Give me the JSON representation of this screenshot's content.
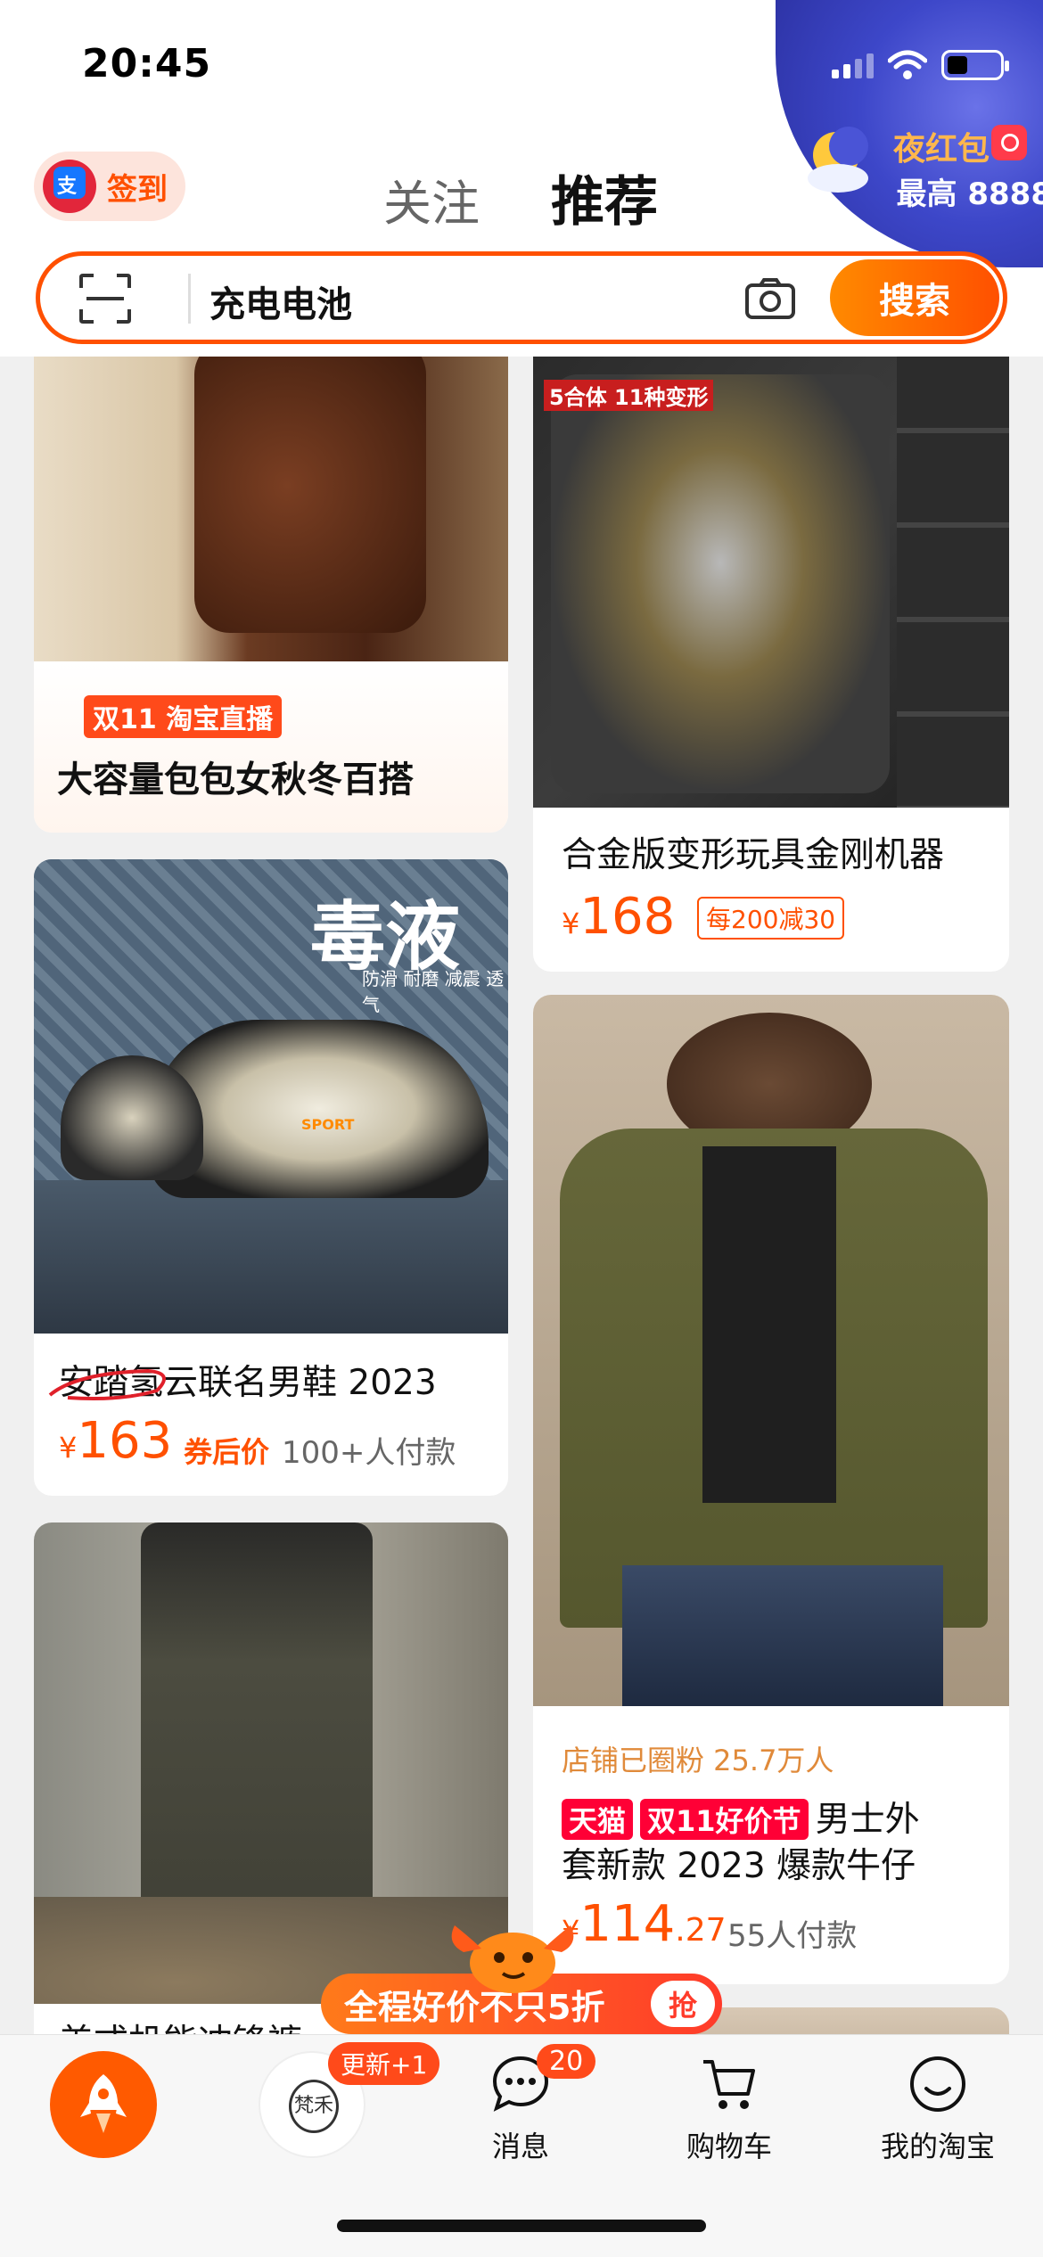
{
  "status_bar": {
    "time": "20:45"
  },
  "header": {
    "checkin_label": "签到",
    "tabs": [
      {
        "label": "关注"
      },
      {
        "label": "推荐"
      }
    ],
    "night_promo": {
      "title": "夜红包",
      "subtitle": "最高 8888"
    }
  },
  "search": {
    "query": "充电电池",
    "button_label": "搜索"
  },
  "feed": {
    "items": [
      {
        "tag": "双11 淘宝直播",
        "title": "大容量包包女秋冬百搭"
      },
      {
        "image_text": "5合体  11种变形",
        "title": "合金版变形玩具金刚机器",
        "price_symbol": "¥",
        "price": "168",
        "coupon": "每200减30"
      },
      {
        "image_text": "毒液",
        "image_subtext": "防滑 耐磨 减震 透气",
        "shoe_logo": "SPORT",
        "title": "安踏氢云联名男鞋 2023",
        "price_symbol": "¥",
        "price": "163",
        "price_note": "券后价",
        "sales": "100+人付款"
      },
      {
        "shop_fans": "店铺已圈粉 25.7万人",
        "badge_tmall": "天猫",
        "badge_event": "双11好价节",
        "title_line1": "男士外",
        "title_line2": "套新款 2023 爆款牛仔",
        "price_symbol": "¥",
        "price": "114",
        "price_decimal": ".27",
        "sales": "55人付款"
      },
      {
        "title": "美式机能冲锋裤"
      }
    ]
  },
  "promo_strip": {
    "label": "全程好价不只5折",
    "action": "抢"
  },
  "tabbar": {
    "store_logo_text": "梵禾",
    "update_badge": "更新+1",
    "messages_count": "20",
    "items": [
      {
        "label": "消息"
      },
      {
        "label": "购物车"
      },
      {
        "label": "我的淘宝"
      }
    ]
  }
}
